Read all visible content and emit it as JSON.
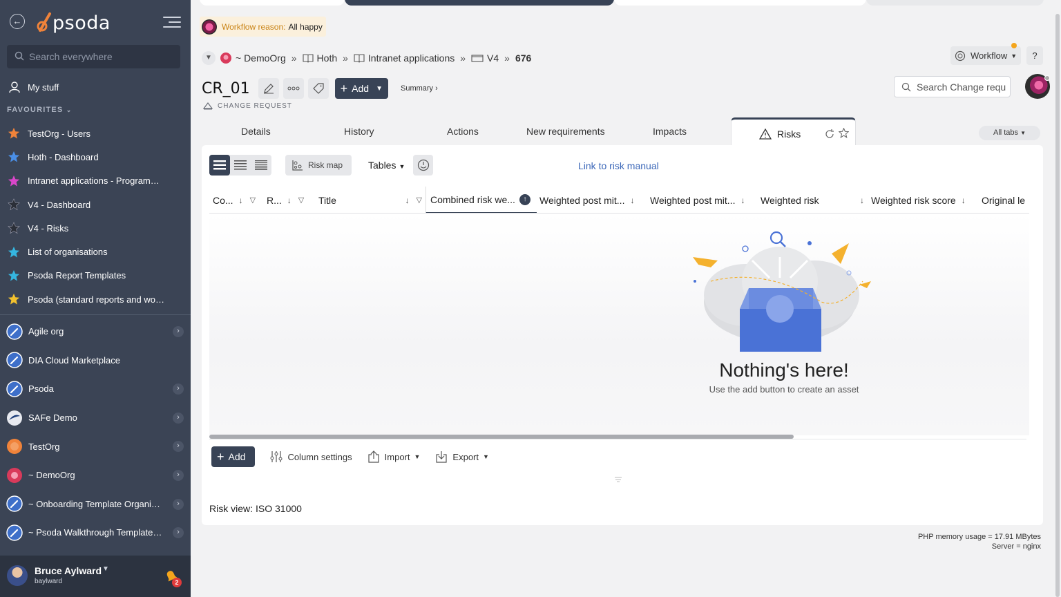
{
  "sidebar": {
    "logo_text": "psoda",
    "search_placeholder": "Search everywhere",
    "my_stuff": "My stuff",
    "favourites_heading": "FAVOURITES",
    "favourites": [
      {
        "label": "TestOrg - Users",
        "star_color": "#f0833a"
      },
      {
        "label": "Hoth - Dashboard",
        "star_color": "#4a8fe7"
      },
      {
        "label": "Intranet applications - Programme...",
        "star_color": "#d946c9"
      },
      {
        "label": "V4 - Dashboard",
        "star_color": "#2b2f38"
      },
      {
        "label": "V4 - Risks",
        "star_color": "#2b2f38"
      },
      {
        "label": "List of organisations",
        "star_color": "#35b6e0"
      },
      {
        "label": "Psoda Report Templates",
        "star_color": "#35b6e0"
      },
      {
        "label": "Psoda (standard reports and work...",
        "star_color": "#f2c12e"
      }
    ],
    "organisations": [
      {
        "label": "Agile org",
        "icon": "rocket-icon",
        "has_children": true
      },
      {
        "label": "DIA Cloud Marketplace",
        "icon": "rocket-icon",
        "has_children": false
      },
      {
        "label": "Psoda",
        "icon": "rocket-icon",
        "has_children": true
      },
      {
        "label": "SAFe Demo",
        "icon": "safe-logo-icon",
        "has_children": true
      },
      {
        "label": "TestOrg",
        "icon": "orange-circle-icon",
        "has_children": true
      },
      {
        "label": "~ DemoOrg",
        "icon": "flower-icon",
        "has_children": true
      },
      {
        "label": "~ Onboarding Template Organisa...",
        "icon": "rocket-icon",
        "has_children": true
      },
      {
        "label": "~ Psoda Walkthrough Template P...",
        "icon": "rocket-icon",
        "has_children": true
      }
    ],
    "user": {
      "name": "Bruce Aylward",
      "username": "baylward",
      "notifications": "2"
    }
  },
  "header": {
    "workflow_reason_label": "Workflow reason:",
    "workflow_reason_value": "All happy",
    "breadcrumbs": [
      {
        "label": "~ DemoOrg",
        "icon": "flower-icon"
      },
      {
        "label": "Hoth",
        "icon": "book-icon"
      },
      {
        "label": "Intranet applications",
        "icon": "book-icon"
      },
      {
        "label": "V4",
        "icon": "folder-icon"
      },
      {
        "label": "676",
        "icon": ""
      }
    ],
    "title": "CR_01",
    "subtitle": "CHANGE REQUEST",
    "add_label": "Add",
    "summary_label": "Summary ›",
    "workflow_label": "Workflow",
    "help_label": "?",
    "search_placeholder": "Search Change requ"
  },
  "tabs": {
    "items": [
      "Details",
      "History",
      "Actions",
      "New requirements",
      "Impacts",
      "Risks"
    ],
    "active": "Risks",
    "all_tabs_label": "All tabs"
  },
  "toolbar": {
    "risk_map_label": "Risk map",
    "tables_label": "Tables",
    "risk_manual_link": "Link to risk manual"
  },
  "table": {
    "columns": [
      "Co...",
      "R...",
      "Title",
      "Combined risk we...",
      "Weighted post mit...",
      "Weighted post mit...",
      "Weighted risk",
      "Weighted risk score",
      "Original le"
    ],
    "empty_title": "Nothing's here!",
    "empty_subtitle": "Use the add button to create an asset"
  },
  "bottom": {
    "add_label": "Add",
    "column_settings_label": "Column settings",
    "import_label": "Import",
    "export_label": "Export",
    "risk_view_label": "Risk view:",
    "risk_view_value": "ISO 31000"
  },
  "footer": {
    "memory": "PHP memory usage = 17.91 MBytes",
    "server": "Server = nginx"
  },
  "colors": {
    "sidebar_bg": "#3b4455",
    "accent_dark": "#384356",
    "link": "#3b67b8",
    "workflow_reason_bg": "#fbf0dc"
  }
}
